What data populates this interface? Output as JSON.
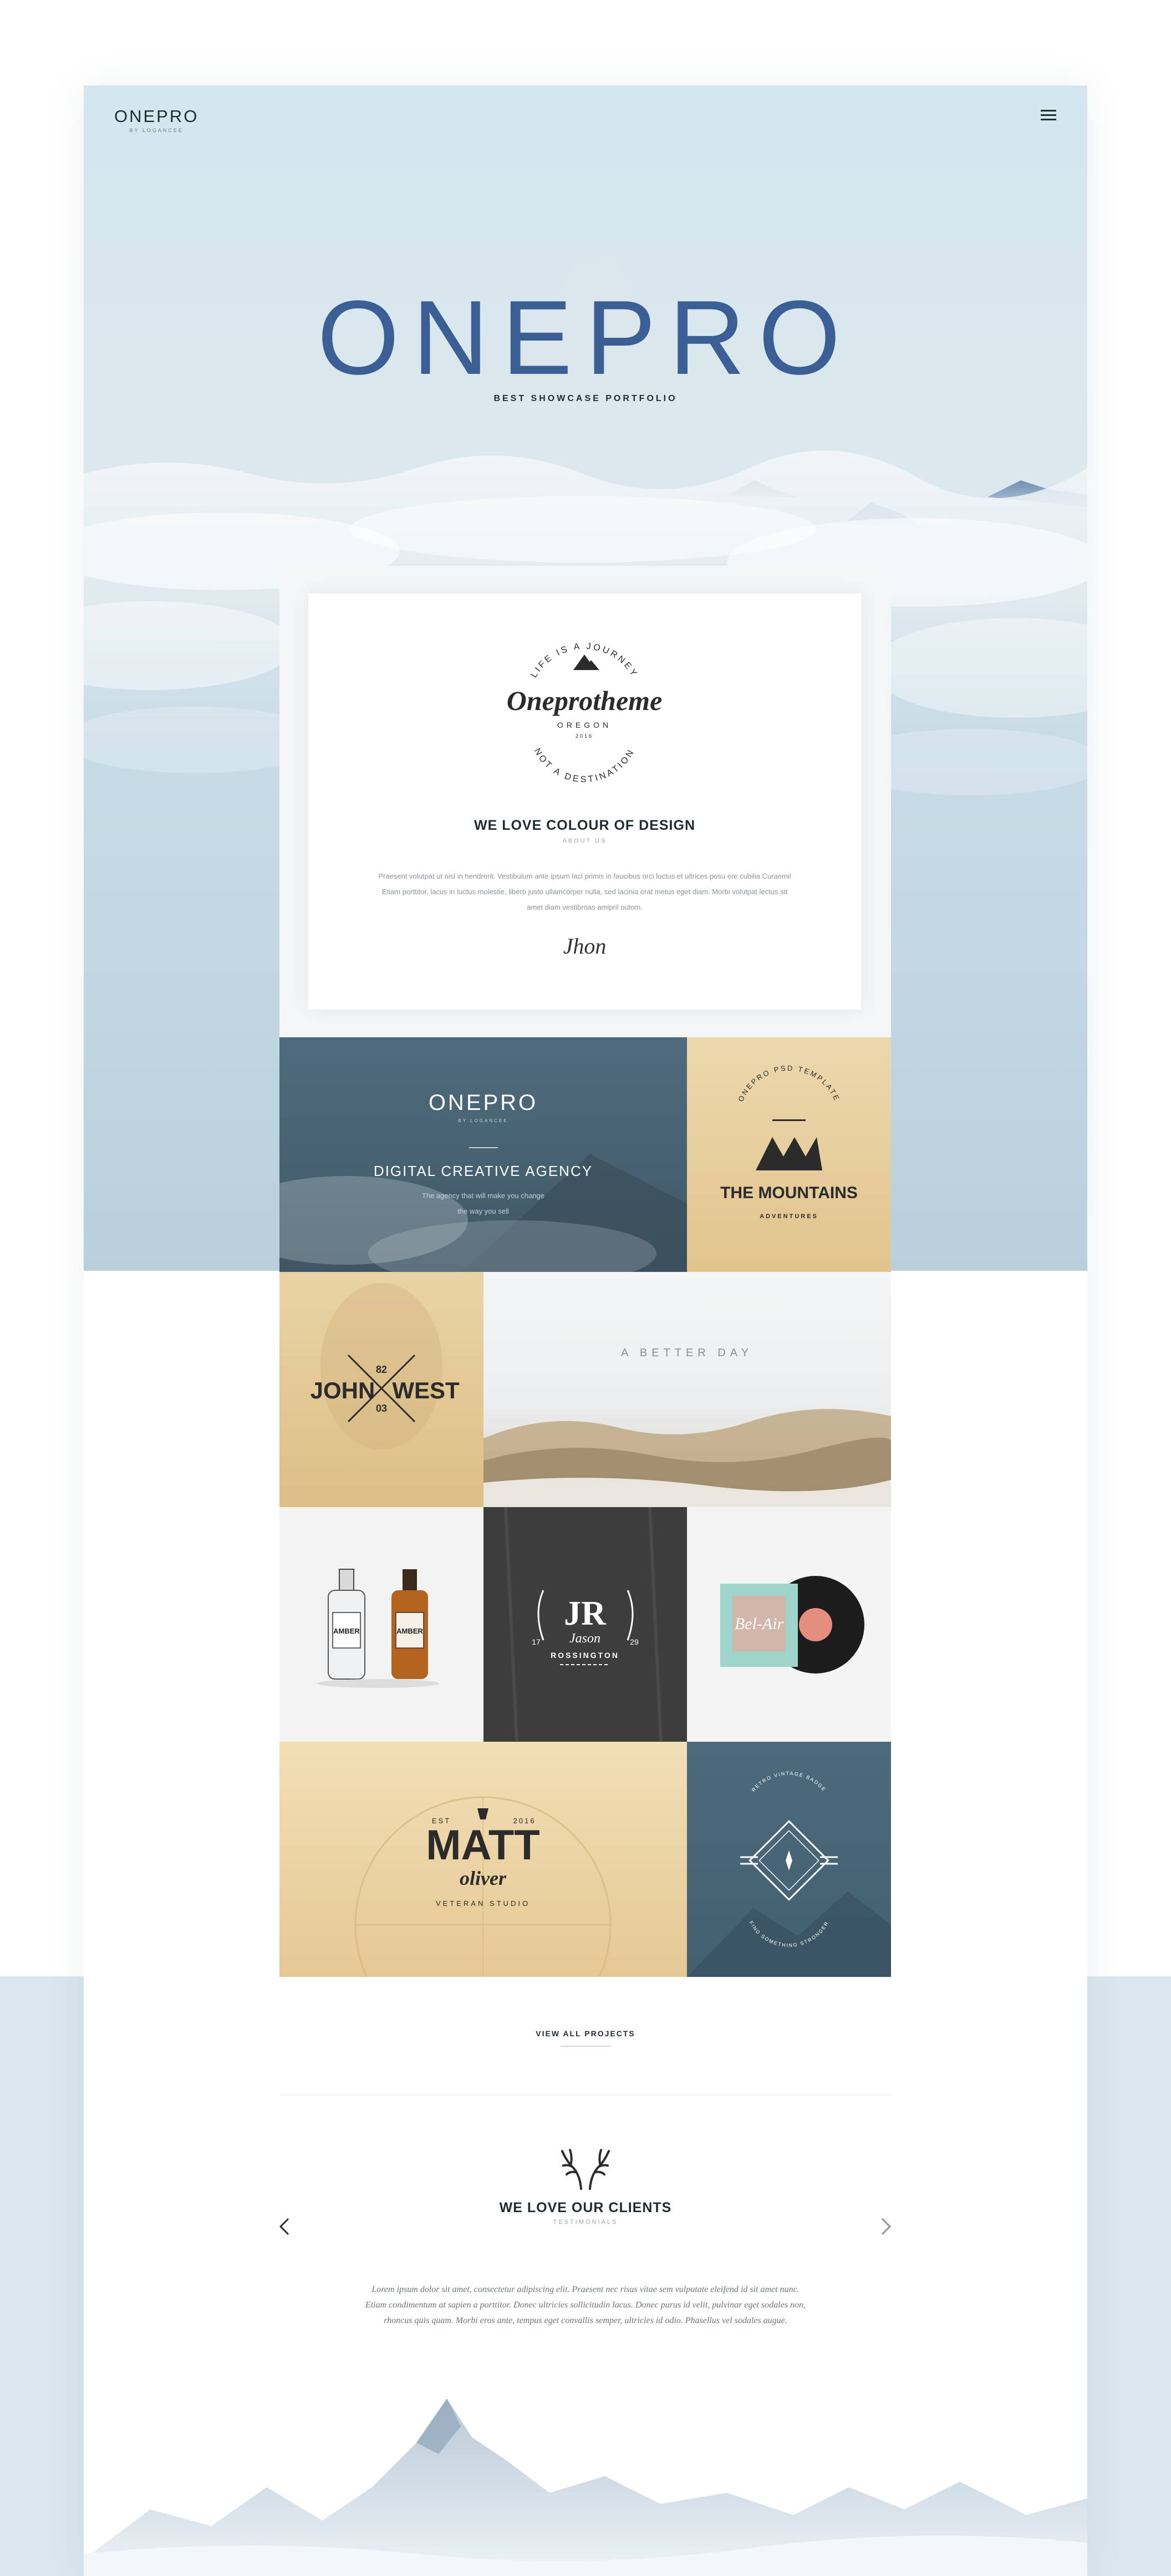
{
  "header": {
    "brand": "ONEPRO",
    "brand_tagline": "BY LOGANCEE",
    "menu_icon": "hamburger-icon"
  },
  "hero": {
    "title": "ONEPRO",
    "subtitle": "BEST SHOWCASE PORTFOLIO"
  },
  "about": {
    "badge": {
      "top_arc": "LIFE IS A JOURNEY",
      "script": "Oneprotheme",
      "location": "OREGON",
      "year": "2016",
      "bottom_arc": "NOT A DESTINATION"
    },
    "heading": "WE LOVE COLOUR OF DESIGN",
    "subheading": "ABOUT US",
    "body": "Praesent volutpat ut nisl in hendrerit. Vestibulum ante ipsum lacl primis in faucibus orci luctus et ultrices posu ere cubilia Curaemil Etiam porttitor, lacus in luctus molestie, libero justo ullamcorper nulla, sed lacinia erat metus eget diam. Morbi volutpat lectus sit amet diam vestibroas amipril outom.",
    "signature": "Jhon"
  },
  "portfolio": {
    "agency": {
      "brand": "ONEPRO",
      "brand_tagline": "BY LOGANCEE",
      "title": "DIGITAL CREATIVE AGENCY",
      "line1": "The agency that will make you change",
      "line2": "the way you sell"
    },
    "mountains": {
      "arc": "ONEPRO PSD TEMPLATE",
      "title": "THE MOUNTAINS",
      "sub": "ADVENTURES"
    },
    "johnwest": {
      "left": "JOHN",
      "right": "WEST",
      "top_num": "82",
      "bottom_num": "03"
    },
    "betterday": {
      "title": "A BETTER DAY"
    },
    "amber": {
      "label1": "AMBER",
      "label2": "AMBER"
    },
    "jr": {
      "monogram": "JR",
      "script": "Jason",
      "name": "ROSSINGTON",
      "left_num": "17",
      "right_num": "29"
    },
    "belair": {
      "title": "Bel-Air"
    },
    "matt": {
      "arc_left": "EST",
      "arc_right": "2016",
      "title": "MATT",
      "script": "oliver",
      "sub": "VETERAN STUDIO"
    },
    "emblem": {
      "arc_top": "RETRO VINTAGE BADGE",
      "arc_bottom": "FIND SOMETHING STRONGER"
    }
  },
  "projects_button": "VIEW ALL PROJECTS",
  "testimonials": {
    "title": "WE LOVE OUR CLIENTS",
    "subtitle": "TESTIMONIALS",
    "body": "Lorem ipsum dolor sit amet, consectetur adipiscing elit. Praesent nec risus vitae sem vulputate eleifend id sit amet nunc. Etiam condimentum at sapien a porttitor. Donec ultricies sollicitudin lacus. Donec purus id velit, pulvinar eget sodales non, rhoncus quis quam. Morbi eros ante, tempus eget convallis semper, ultricies id odio. Phasellus vel sodales augue.",
    "prev_icon": "chevron-left-icon",
    "next_icon": "chevron-right-icon",
    "antler_icon": "antler-icon"
  },
  "colors": {
    "sky": "#d4e6ee",
    "deep_blue": "#4e6a7b",
    "sand": "#e8cf9d",
    "charcoal": "#3a3a3a",
    "ink": "#1e2b33"
  }
}
